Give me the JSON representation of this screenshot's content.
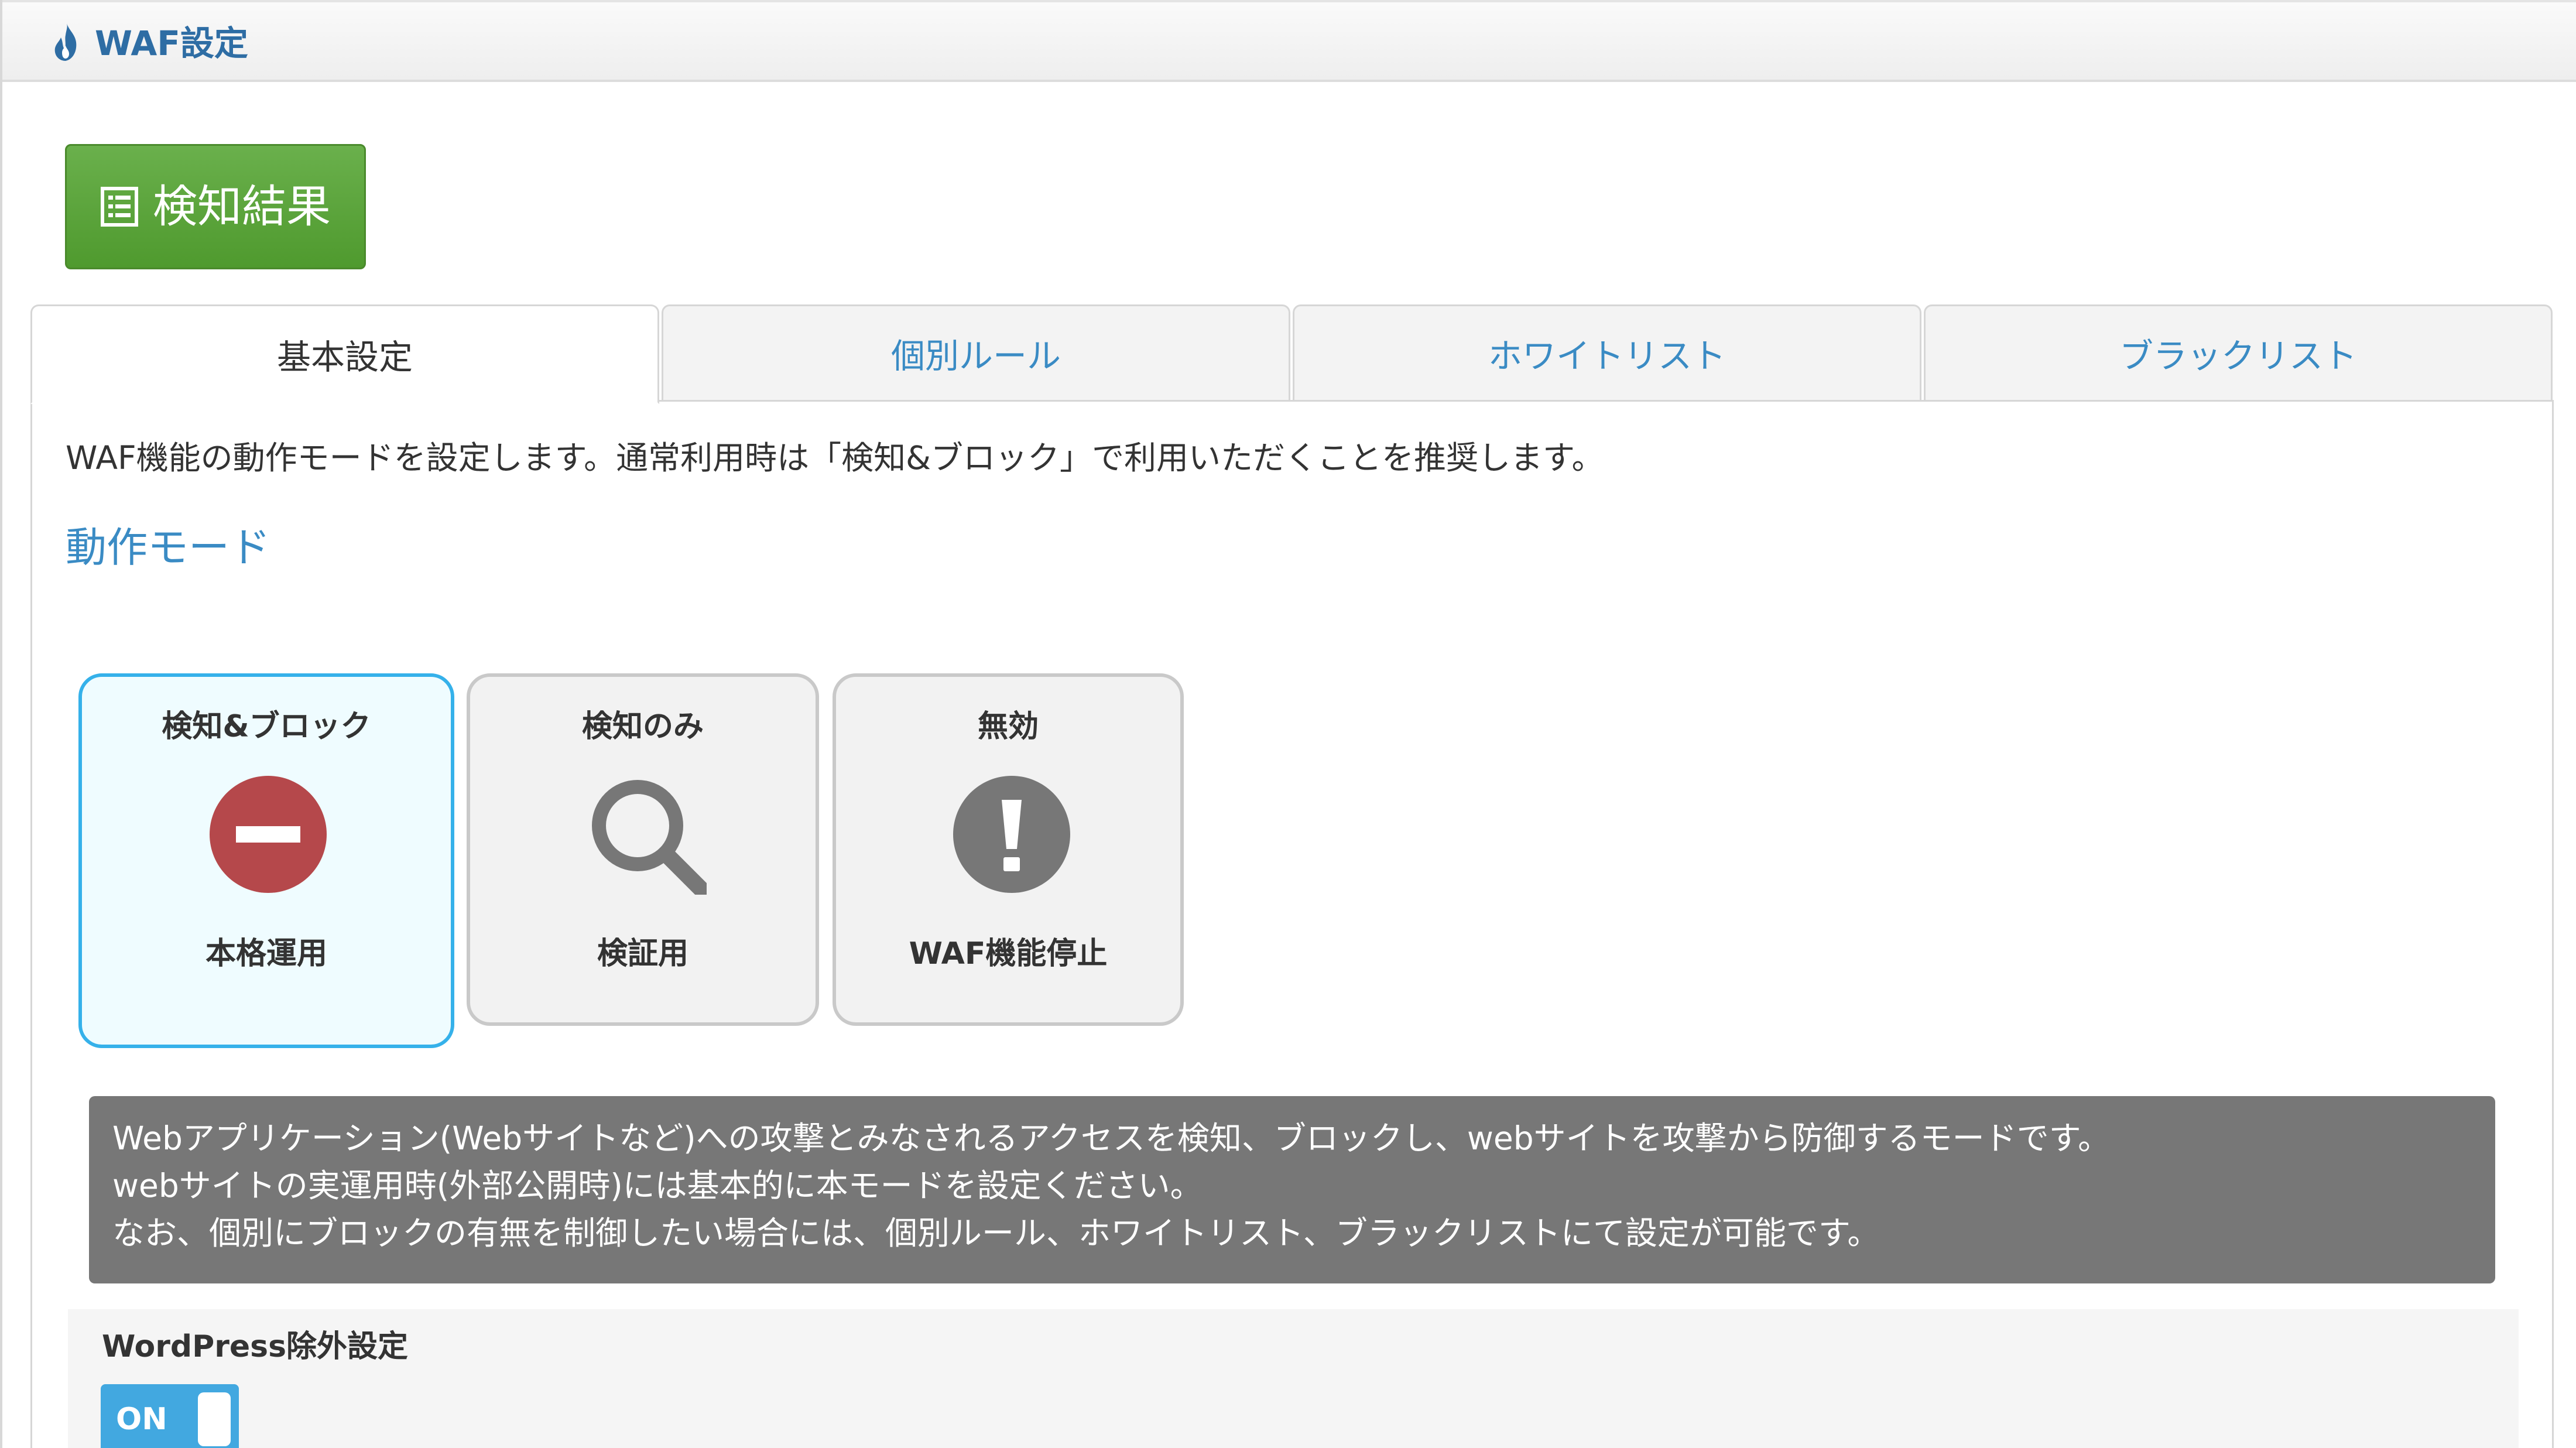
{
  "header": {
    "title": "WAF設定",
    "icon": "flame-icon"
  },
  "result_button": {
    "label": "検知結果",
    "icon": "list-icon"
  },
  "tabs": [
    {
      "label": "基本設定",
      "active": true
    },
    {
      "label": "個別ルール",
      "active": false
    },
    {
      "label": "ホワイトリスト",
      "active": false
    },
    {
      "label": "ブラックリスト",
      "active": false
    }
  ],
  "intro_text": "WAF機能の動作モードを設定します。通常利用時は「検知&ブロック」で利用いただくことを推奨します。",
  "mode_heading": "動作モード",
  "modes": [
    {
      "title": "検知&ブロック",
      "subtitle": "本格運用",
      "icon": "block-icon",
      "selected": true
    },
    {
      "title": "検知のみ",
      "subtitle": "検証用",
      "icon": "magnifier-icon",
      "selected": false
    },
    {
      "title": "無効",
      "subtitle": "WAF機能停止",
      "icon": "exclamation-icon",
      "selected": false
    }
  ],
  "info_lines": [
    "Webアプリケーション(Webサイトなど)への攻撃とみなされるアクセスを検知、ブロックし、webサイトを攻撃から防御するモードです。",
    "webサイトの実運用時(外部公開時)には基本的に本モードを設定ください。",
    "なお、個別にブロックの有無を制御したい場合には、個別ルール、ホワイトリスト、ブラックリストにて設定が可能です。"
  ],
  "wordpress": {
    "label": "WordPress除外設定",
    "toggle_text": "ON",
    "toggle_state": "on"
  },
  "colors": {
    "accent_blue": "#3a8bc4",
    "button_green": "#5ba63a",
    "block_red": "#b5484b",
    "selected_border": "#35b1ea",
    "info_bg": "#777777",
    "toggle_blue": "#42a8e0"
  }
}
